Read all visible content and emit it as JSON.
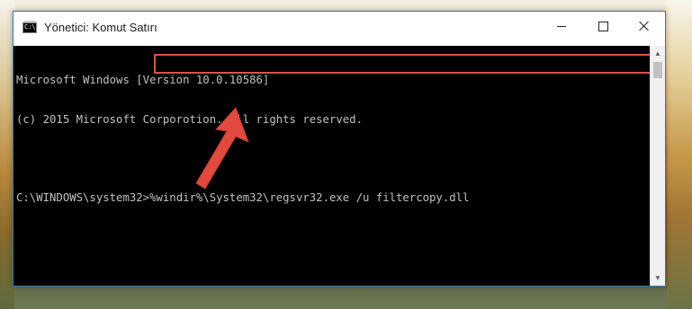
{
  "window": {
    "title": "Yönetici: Komut Satırı"
  },
  "console": {
    "lines": [
      "Microsoft Windows [Version 10.0.10586]",
      "(c) 2015 Microsoft Corporotion. All rights reserved."
    ],
    "prompt": "C:\\WINDOWS\\system32>",
    "command": "%windir%\\System32\\regsvr32.exe /u filtercopy.dll"
  },
  "colors": {
    "console_bg": "#000000",
    "console_text": "#c0c0c0",
    "highlight": "#d9534f",
    "arrow": "#e04a3f"
  },
  "icons": {
    "app": "cmd-icon",
    "minimize": "minimize-icon",
    "maximize": "maximize-icon",
    "close": "close-icon",
    "pointer": "red-arrow-icon"
  }
}
